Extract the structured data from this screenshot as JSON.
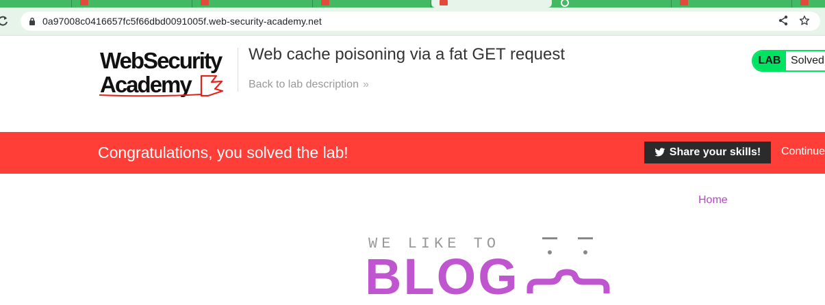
{
  "browser": {
    "url": "0a97008c0416657fc5f66dbd0091005f.web-security-academy.net",
    "icons": [
      "reload-icon",
      "lock-icon",
      "share-icon",
      "star-icon"
    ]
  },
  "header": {
    "logo_line1": "WebSecurity",
    "logo_line2": "Academy",
    "lab_title": "Web cache poisoning via a fat GET request",
    "back_link": "Back to lab description",
    "badge_lab": "LAB",
    "badge_status": "Solved"
  },
  "banner": {
    "message": "Congratulations, you solved the lab!",
    "share_label": "Share your skills!",
    "continue_label": "Continue"
  },
  "blog": {
    "nav_home": "Home",
    "tagline": "WE LIKE TO",
    "word": "BLOG"
  },
  "colors": {
    "chrome_green": "#44b964",
    "banner_red": "#ff3e38",
    "badge_green": "#00e261",
    "blog_purple": "#c056cf"
  }
}
